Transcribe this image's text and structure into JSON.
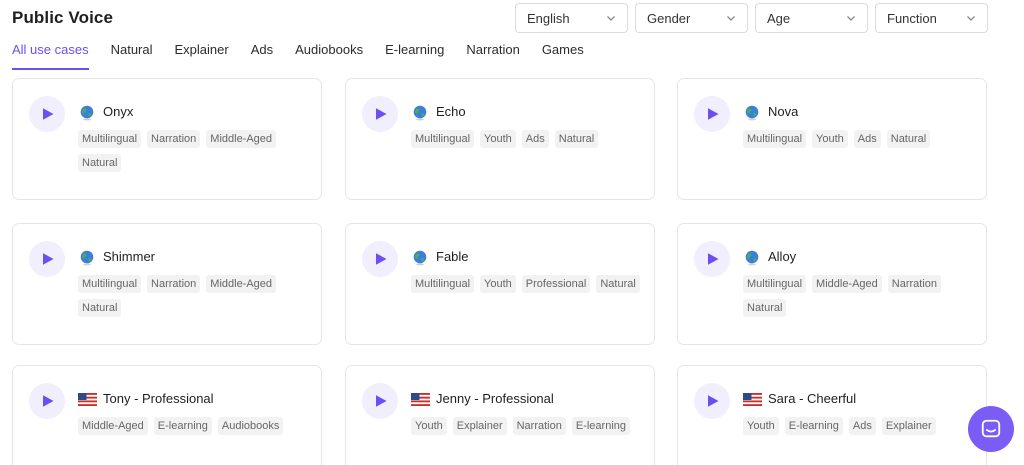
{
  "header": {
    "title": "Public Voice"
  },
  "filters": [
    {
      "label": "English"
    },
    {
      "label": "Gender"
    },
    {
      "label": "Age"
    },
    {
      "label": "Function"
    }
  ],
  "tabs": [
    {
      "label": "All use cases",
      "active": true
    },
    {
      "label": "Natural"
    },
    {
      "label": "Explainer"
    },
    {
      "label": "Ads"
    },
    {
      "label": "Audiobooks"
    },
    {
      "label": "E-learning"
    },
    {
      "label": "Narration"
    },
    {
      "label": "Games"
    }
  ],
  "voices": [
    {
      "name": "Onyx",
      "flag": "globe-icon",
      "tags": [
        "Multilingual",
        "Narration",
        "Middle-Aged",
        "Natural"
      ]
    },
    {
      "name": "Echo",
      "flag": "globe-icon",
      "tags": [
        "Multilingual",
        "Youth",
        "Ads",
        "Natural"
      ]
    },
    {
      "name": "Nova",
      "flag": "globe-icon",
      "tags": [
        "Multilingual",
        "Youth",
        "Ads",
        "Natural"
      ]
    },
    {
      "name": "Shimmer",
      "flag": "globe-icon",
      "tags": [
        "Multilingual",
        "Narration",
        "Middle-Aged",
        "Natural"
      ]
    },
    {
      "name": "Fable",
      "flag": "globe-icon",
      "tags": [
        "Multilingual",
        "Youth",
        "Professional",
        "Natural"
      ]
    },
    {
      "name": "Alloy",
      "flag": "globe-icon",
      "tags": [
        "Multilingual",
        "Middle-Aged",
        "Narration",
        "Natural"
      ]
    },
    {
      "name": "Tony - Professional",
      "flag": "us-flag-icon",
      "tags": [
        "Middle-Aged",
        "E-learning",
        "Audiobooks"
      ]
    },
    {
      "name": "Jenny - Professional",
      "flag": "us-flag-icon",
      "tags": [
        "Youth",
        "Explainer",
        "Narration",
        "E-learning"
      ]
    },
    {
      "name": "Sara - Cheerful",
      "flag": "us-flag-icon",
      "tags": [
        "Youth",
        "E-learning",
        "Ads",
        "Explainer"
      ]
    }
  ],
  "colors": {
    "accent": "#6c4ef2",
    "chat": "#7b5cf5",
    "tag_bg": "#f2f2f2"
  }
}
